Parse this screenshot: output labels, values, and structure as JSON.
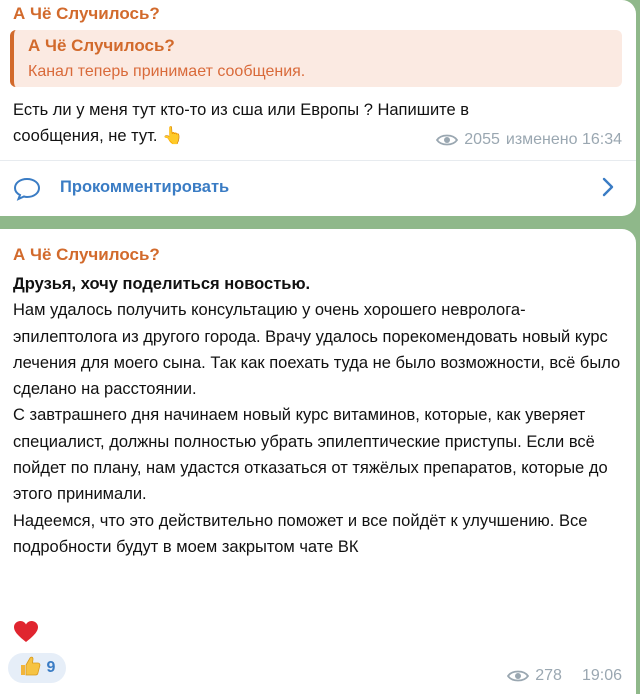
{
  "post1": {
    "channel": "А Чё Случилось?",
    "reply": {
      "name": "А Чё Случилось?",
      "text": "Канал теперь принимает сообщения."
    },
    "text": "Есть ли у меня тут кто-то из сша или Европы ? Напишите в сообщения, не тут.",
    "emoji": "👆",
    "views": "2055",
    "status": "изменено 16:34",
    "comment_label": "Прокомментировать"
  },
  "post2": {
    "channel": "А Чё Случилось?",
    "title": "Друзья, хочу поделиться новостью.",
    "paragraphs": [
      "Нам удалось получить консультацию у очень хорошего невролога-эпилептолога из другого города. Врачу удалось порекомендовать новый курс лечения для моего сына. Так как поехать туда не было возможности, всё было сделано на расстоянии.",
      "С завтрашнего дня начинаем новый курс витаминов, которые, как уверяет специалист, должны полностью убрать эпилептические приступы. Если всё пойдет по плану, нам удастся отказаться от тяжёлых препаратов, которые до этого принимали.",
      "Надеемся, что это действительно поможет и все пойдёт к улучшению. Все подробности будут  в моем закрытом чате ВК"
    ],
    "emoji": "❤️",
    "reaction": {
      "icon": "thumbs-up-icon",
      "count": "9"
    },
    "views": "278",
    "time": "19:06"
  },
  "colors": {
    "background": "#8fb88a",
    "channel_name": "#d26a2c",
    "link": "#3a7cc4",
    "meta": "#9aa7b1",
    "reply_bg": "#fbeae2"
  }
}
